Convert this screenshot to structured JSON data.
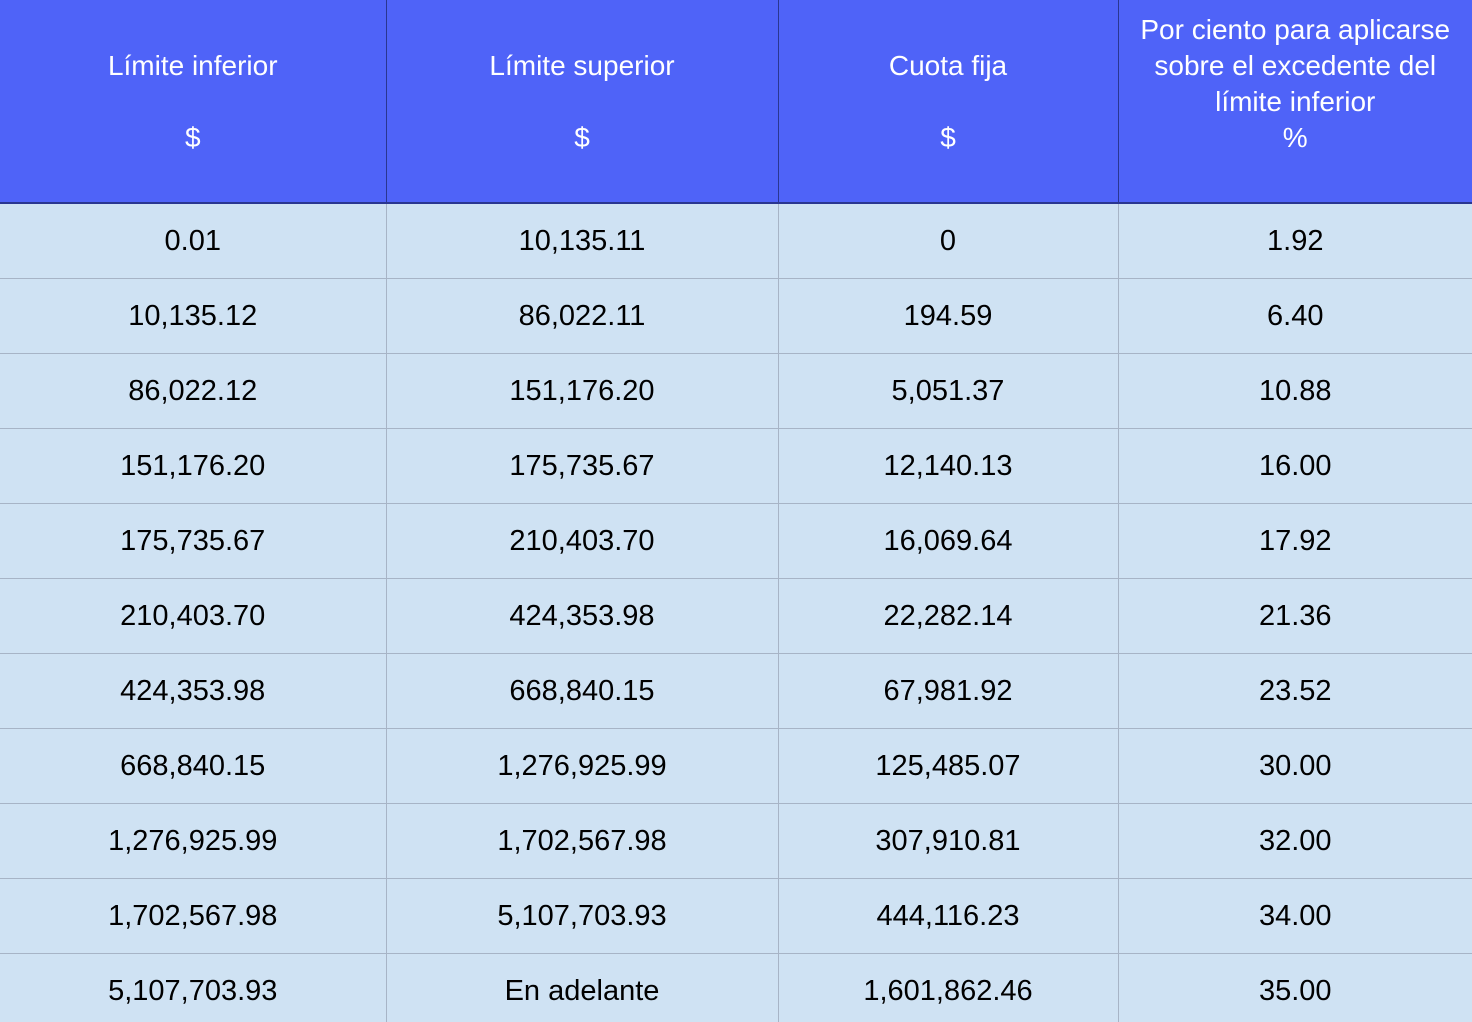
{
  "table": {
    "headers": [
      {
        "lines": [
          "Límite inferior"
        ],
        "unit": "$"
      },
      {
        "lines": [
          "Límite superior"
        ],
        "unit": "$"
      },
      {
        "lines": [
          "Cuota fija"
        ],
        "unit": "$"
      },
      {
        "lines": [
          "Por ciento para aplicarse",
          "sobre el excedente del",
          "límite inferior"
        ],
        "unit": "%"
      }
    ],
    "rows": [
      [
        "0.01",
        "10,135.11",
        "0",
        "1.92"
      ],
      [
        "10,135.12",
        "86,022.11",
        "194.59",
        "6.40"
      ],
      [
        "86,022.12",
        "151,176.20",
        "5,051.37",
        "10.88"
      ],
      [
        "151,176.20",
        "175,735.67",
        "12,140.13",
        "16.00"
      ],
      [
        "175,735.67",
        "210,403.70",
        "16,069.64",
        "17.92"
      ],
      [
        "210,403.70",
        "424,353.98",
        "22,282.14",
        "21.36"
      ],
      [
        "424,353.98",
        "668,840.15",
        "67,981.92",
        "23.52"
      ],
      [
        "668,840.15",
        "1,276,925.99",
        "125,485.07",
        "30.00"
      ],
      [
        "1,276,925.99",
        "1,702,567.98",
        "307,910.81",
        "32.00"
      ],
      [
        "1,702,567.98",
        "5,107,703.93",
        "444,116.23",
        "34.00"
      ],
      [
        "5,107,703.93",
        "En adelante",
        "1,601,862.46",
        "35.00"
      ]
    ]
  },
  "colors": {
    "header_bg": "#4f63f8",
    "header_text": "#ffffff",
    "body_bg": "#cfe2f3",
    "grid_line": "#a7b4c6"
  }
}
